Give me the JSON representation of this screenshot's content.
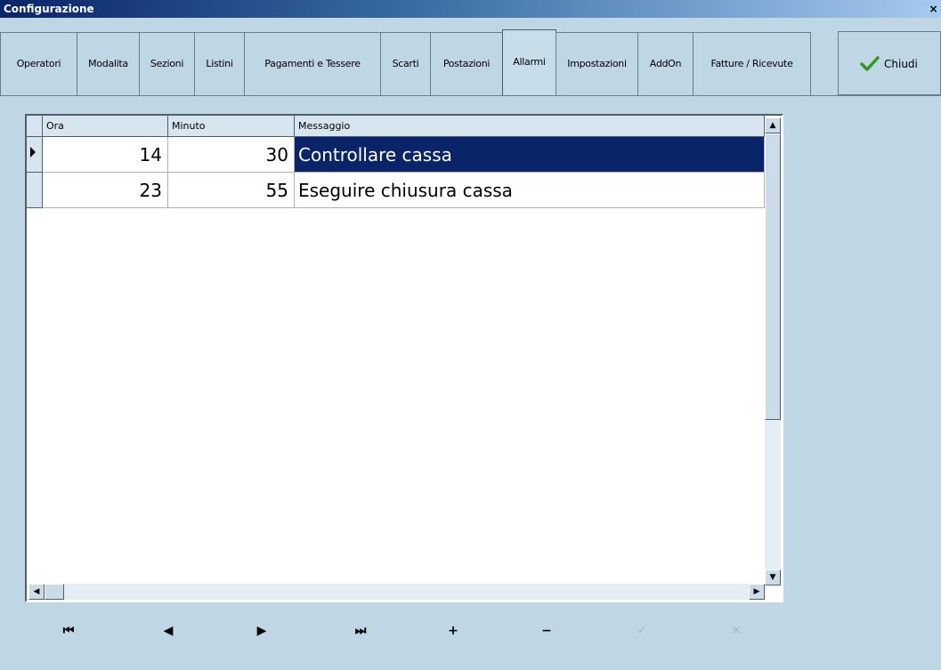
{
  "window": {
    "title": "Configurazione",
    "close_glyph": "×"
  },
  "tabs": [
    {
      "label": "Operatori"
    },
    {
      "label": "Modalita"
    },
    {
      "label": "Sezioni"
    },
    {
      "label": "Listini"
    },
    {
      "label": "Pagamenti e Tessere"
    },
    {
      "label": "Scarti"
    },
    {
      "label": "Postazioni"
    },
    {
      "label": "Allarmi",
      "active": true
    },
    {
      "label": "Impostazioni"
    },
    {
      "label": "AddOn"
    },
    {
      "label": "Fatture / Ricevute"
    }
  ],
  "close_button": {
    "label": "Chiudi",
    "icon": "checkmark-icon",
    "icon_color": "#2e9a1e"
  },
  "grid": {
    "columns": [
      "Ora",
      "Minuto",
      "Messaggio"
    ],
    "rows": [
      {
        "ora": "14",
        "minuto": "30",
        "messaggio": "Controllare cassa",
        "selected": true
      },
      {
        "ora": "23",
        "minuto": "55",
        "messaggio": "Eseguire chiusura cassa",
        "selected": false
      }
    ]
  },
  "navigator": [
    {
      "name": "first-record",
      "glyph": "⏮",
      "enabled": true
    },
    {
      "name": "prior-record",
      "glyph": "◀",
      "enabled": true
    },
    {
      "name": "next-record",
      "glyph": "▶",
      "enabled": true
    },
    {
      "name": "last-record",
      "glyph": "⏭",
      "enabled": true
    },
    {
      "name": "insert-record",
      "glyph": "+",
      "enabled": true
    },
    {
      "name": "delete-record",
      "glyph": "−",
      "enabled": true
    },
    {
      "name": "post-edit",
      "glyph": "✓",
      "enabled": false
    },
    {
      "name": "cancel-edit",
      "glyph": "✕",
      "enabled": false
    }
  ],
  "colors": {
    "background": "#bfd6e4",
    "selection": "#0a246a",
    "title_start": "#0a246a"
  }
}
